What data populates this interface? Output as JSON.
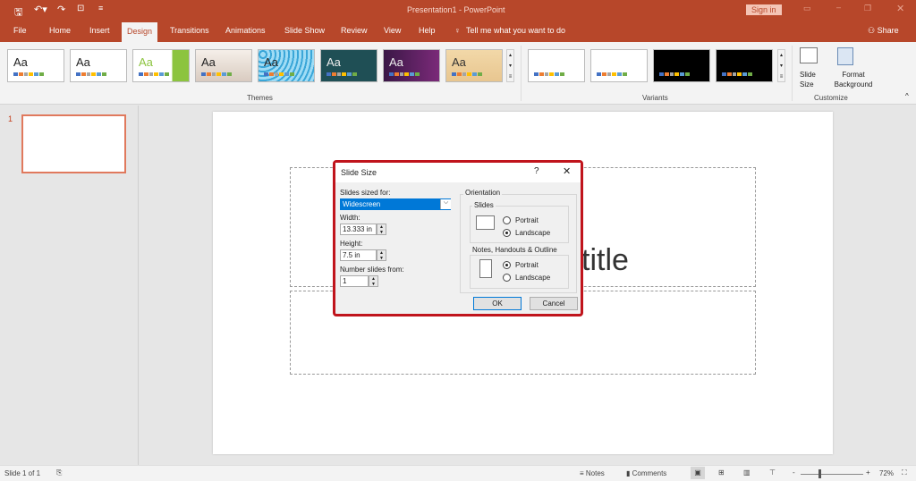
{
  "window": {
    "title": "Presentation1 - PowerPoint",
    "sign_in": "Sign in",
    "share": "Share"
  },
  "tabs": [
    "File",
    "Home",
    "Insert",
    "Design",
    "Transitions",
    "Animations",
    "Slide Show",
    "Review",
    "View",
    "Help"
  ],
  "tell_me": "Tell me what you want to do",
  "ribbon": {
    "themes_label": "Themes",
    "variants_label": "Variants",
    "customize_label": "Customize",
    "slide_size": "Slide Size",
    "format_background": "Format Background",
    "theme_sample": "Aa"
  },
  "slide_pane": {
    "number": "1"
  },
  "slide": {
    "title_fragment": "title"
  },
  "dialog": {
    "title": "Slide Size",
    "help": "?",
    "sized_for_label": "Slides sized for:",
    "sized_for_value": "Widescreen",
    "width_label": "Width:",
    "width_value": "13.333 in",
    "height_label": "Height:",
    "height_value": "7.5 in",
    "number_from_label": "Number slides from:",
    "number_from_value": "1",
    "orientation_label": "Orientation",
    "slides_label": "Slides",
    "notes_label": "Notes, Handouts & Outline",
    "portrait": "Portrait",
    "landscape": "Landscape",
    "ok": "OK",
    "cancel": "Cancel",
    "slides_orientation": "Landscape",
    "notes_orientation": "Portrait"
  },
  "status": {
    "slide_count": "Slide 1 of 1",
    "notes": "Notes",
    "comments": "Comments",
    "zoom": "72%",
    "zoom_level": 72
  },
  "colors": {
    "accent": "#b7472a",
    "dialog_border": "#c0141c",
    "selection": "#0078d7"
  }
}
